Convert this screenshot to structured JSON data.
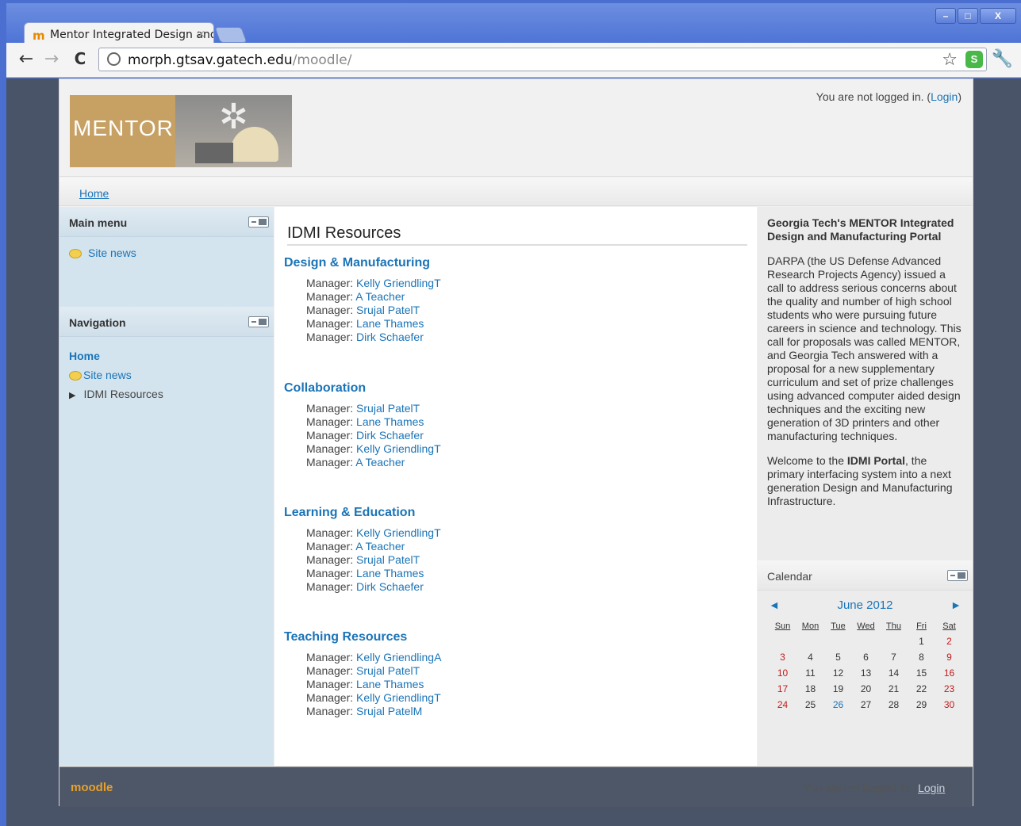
{
  "browser": {
    "tab_title": "Mentor Integrated Design and",
    "tab_close": "×",
    "url_host": "morph.gtsav.gatech.edu",
    "url_path": "/moodle/",
    "back": "←",
    "forward": "→",
    "reload": "C",
    "star": "☆",
    "wrench": "🔧",
    "win_min": "–",
    "win_max": "□",
    "win_close": "X"
  },
  "header": {
    "logo_text": "MENTOR",
    "login_note": "You are not logged in. (",
    "login_link": "Login",
    "login_close": ")"
  },
  "navbar": {
    "home": "Home"
  },
  "left": {
    "main_menu_title": "Main menu",
    "main_menu_item": "Site news",
    "navigation_title": "Navigation",
    "nav_home": "Home",
    "nav_site_news": "Site news",
    "nav_idmi": "IDMI Resources"
  },
  "main": {
    "title": "IDMI Resources",
    "manager_label": "Manager: ",
    "categories": [
      {
        "name": "Design & Manufacturing",
        "managers": [
          "Kelly GriendlingT",
          "A Teacher",
          "Srujal PatelT",
          "Lane Thames",
          "Dirk Schaefer"
        ]
      },
      {
        "name": "Collaboration",
        "managers": [
          "Srujal PatelT",
          "Lane Thames",
          "Dirk Schaefer",
          "Kelly GriendlingT",
          "A Teacher"
        ]
      },
      {
        "name": "Learning & Education",
        "managers": [
          "Kelly GriendlingT",
          "A Teacher",
          "Srujal PatelT",
          "Lane Thames",
          "Dirk Schaefer"
        ]
      },
      {
        "name": "Teaching Resources",
        "managers": [
          "Kelly GriendlingA",
          "Srujal PatelT",
          "Lane Thames",
          "Kelly GriendlingT",
          "Srujal PatelM"
        ]
      }
    ]
  },
  "right": {
    "about_title": "Georgia Tech's MENTOR Integrated Design and Manufacturing Portal",
    "about_p1": "DARPA (the US Defense Advanced Research Projects Agency) issued a call to address serious concerns about the quality and number of high school students who were pursuing future careers in science and technology. This call for proposals was called MENTOR, and Georgia Tech answered with a proposal for a new supplementary curriculum and set of prize challenges using advanced computer aided design techniques and the exciting new generation of 3D printers and other manufacturing techniques.",
    "about_p2_a": "Welcome to the ",
    "about_p2_b": "IDMI Portal",
    "about_p2_c": ", the primary interfacing system into a next generation Design and Manufacturing Infrastructure.",
    "calendar_title": "Calendar",
    "calendar_month": "June 2012",
    "calendar_prev": "◄",
    "calendar_next": "►",
    "weekdays": [
      "Sun",
      "Mon",
      "Tue",
      "Wed",
      "Thu",
      "Fri",
      "Sat"
    ],
    "weeks": [
      [
        "",
        "",
        "",
        "",
        "",
        "1",
        "2"
      ],
      [
        "3",
        "4",
        "5",
        "6",
        "7",
        "8",
        "9"
      ],
      [
        "10",
        "11",
        "12",
        "13",
        "14",
        "15",
        "16"
      ],
      [
        "17",
        "18",
        "19",
        "20",
        "21",
        "22",
        "23"
      ],
      [
        "24",
        "25",
        "26",
        "27",
        "28",
        "29",
        "30"
      ]
    ],
    "today": "26"
  },
  "footer": {
    "moodle": "moodle",
    "note": "You are not logged in. (",
    "login": "Login",
    "close": ")"
  }
}
